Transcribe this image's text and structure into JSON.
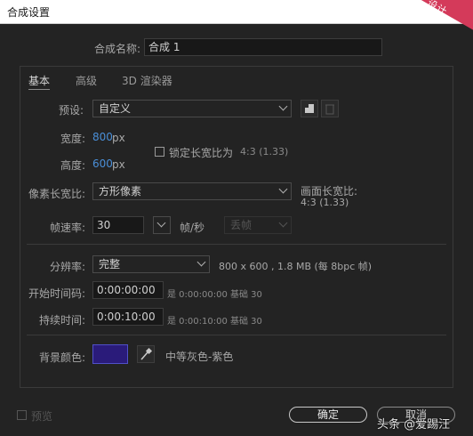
{
  "window": {
    "title": "合成设置",
    "corner_badge": "设计"
  },
  "name_row": {
    "label": "合成名称:",
    "value": "合成 1"
  },
  "tabs": [
    {
      "label": "基本"
    },
    {
      "label": "高级"
    },
    {
      "label": "3D 渲染器"
    }
  ],
  "preset": {
    "label": "预设:",
    "value": "自定义"
  },
  "width": {
    "label": "宽度:",
    "value": "800",
    "unit": "px"
  },
  "height": {
    "label": "高度:",
    "value": "600",
    "unit": "px"
  },
  "lock_aspect": {
    "label": "锁定长宽比为",
    "value": "4:3 (1.33)",
    "checked": false
  },
  "pixel_aspect": {
    "label": "像素长宽比:",
    "value": "方形像素"
  },
  "frame_aspect": {
    "label": "画面长宽比:",
    "value": "4:3 (1.33)"
  },
  "frame_rate": {
    "label": "帧速率:",
    "value": "30",
    "unit": "帧/秒",
    "dropdown": "丢帧"
  },
  "resolution": {
    "label": "分辨率:",
    "value": "完整",
    "info": "800 x 600 , 1.8 MB (每 8bpc 帧)"
  },
  "start_timecode": {
    "label": "开始时间码:",
    "value": "0:00:00:00",
    "info": "是 0:00:00:00  基础 30"
  },
  "duration": {
    "label": "持续时间:",
    "value": "0:00:10:00",
    "info": "是 0:00:10:00  基础 30"
  },
  "background": {
    "label": "背景颜色:",
    "swatch_color": "#2a1b7a",
    "name": "中等灰色-紫色"
  },
  "footer": {
    "preview_label": "预览",
    "ok": "确定",
    "cancel": "取消"
  },
  "watermark": "头条 @爱踢汪",
  "icons": [
    "save-preset-icon",
    "delete-preset-icon",
    "eyedropper-icon",
    "chevron-down-icon"
  ]
}
